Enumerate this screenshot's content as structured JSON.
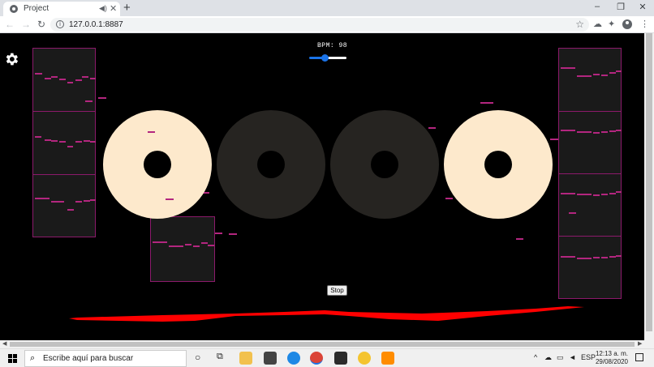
{
  "browser": {
    "tab_title": "Project",
    "tab_audio": "◀︎)",
    "tab_close": "✕",
    "new_tab": "+",
    "url": "127.0.0.1:8887",
    "window_controls": {
      "minimize": "–",
      "maximize": "❐",
      "close": "✕"
    }
  },
  "app": {
    "bpm_label": "BPM: 98",
    "bpm_value": 98,
    "slider_fraction": 0.43,
    "stop_label": "Stop",
    "colors": {
      "grid_border": "#8c1a6b",
      "note": "#b3267f",
      "disc_active": "#fde9cc",
      "disc_inactive": "#262421",
      "wave": "#ff0000"
    },
    "discs": [
      {
        "state": "active"
      },
      {
        "state": "inactive"
      },
      {
        "state": "inactive"
      },
      {
        "state": "active"
      }
    ]
  },
  "taskbar": {
    "search_placeholder": "Escribe aquí para buscar",
    "language": "ESP",
    "time": "12:13 a. m.",
    "date": "29/08/2020",
    "tray_caret": "^"
  }
}
